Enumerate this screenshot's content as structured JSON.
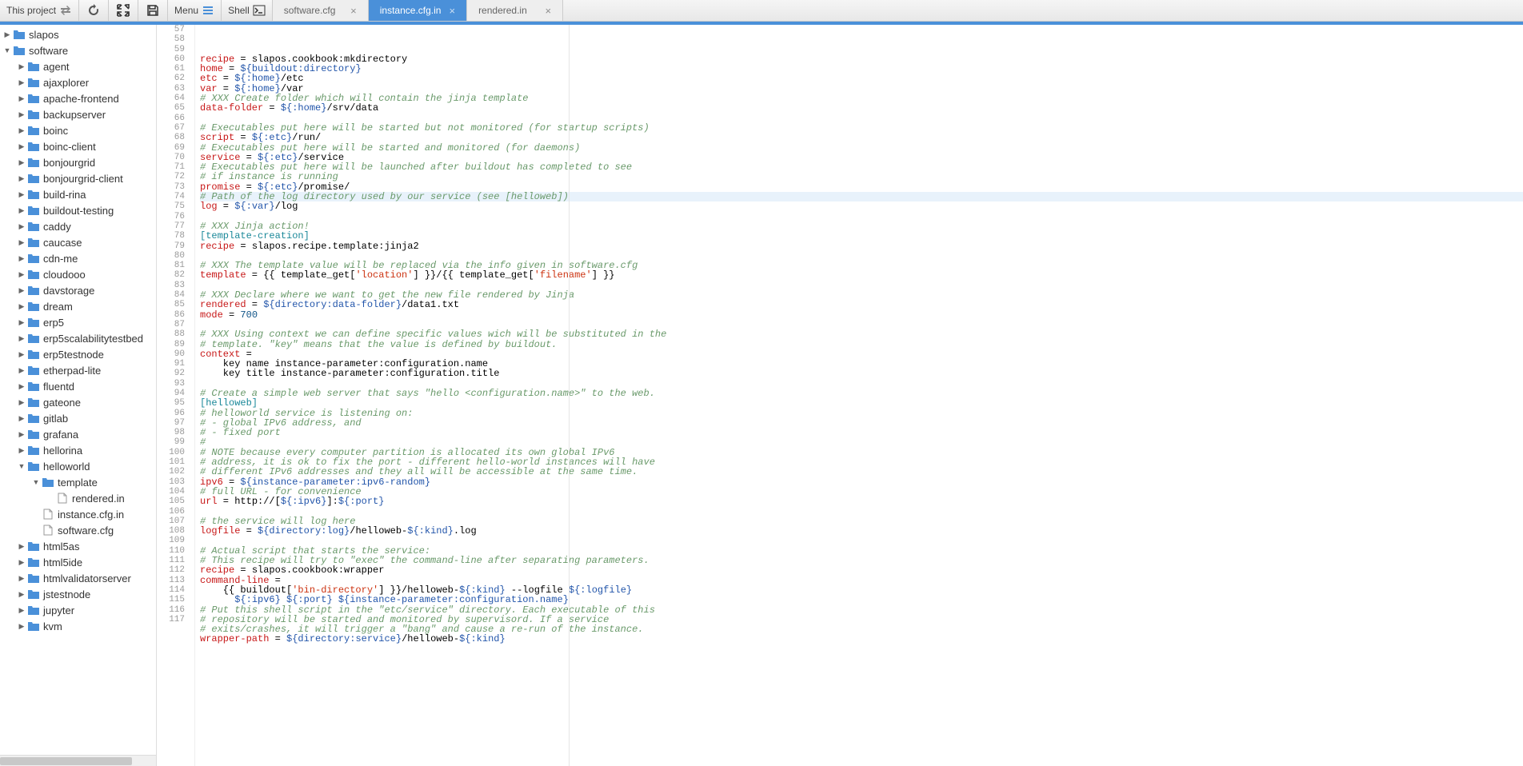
{
  "toolbar": {
    "project_label": "This project",
    "menu_label": "Menu",
    "shell_label": "Shell"
  },
  "tabs": [
    {
      "label": "software.cfg",
      "active": false
    },
    {
      "label": "instance.cfg.in",
      "active": true
    },
    {
      "label": "rendered.in",
      "active": false
    }
  ],
  "tree": [
    {
      "depth": 0,
      "label": "slapos",
      "type": "folder",
      "toggle": "▶"
    },
    {
      "depth": 0,
      "label": "software",
      "type": "folder",
      "toggle": "▼"
    },
    {
      "depth": 1,
      "label": "agent",
      "type": "folder",
      "toggle": "▶"
    },
    {
      "depth": 1,
      "label": "ajaxplorer",
      "type": "folder",
      "toggle": "▶"
    },
    {
      "depth": 1,
      "label": "apache-frontend",
      "type": "folder",
      "toggle": "▶"
    },
    {
      "depth": 1,
      "label": "backupserver",
      "type": "folder",
      "toggle": "▶"
    },
    {
      "depth": 1,
      "label": "boinc",
      "type": "folder",
      "toggle": "▶"
    },
    {
      "depth": 1,
      "label": "boinc-client",
      "type": "folder",
      "toggle": "▶"
    },
    {
      "depth": 1,
      "label": "bonjourgrid",
      "type": "folder",
      "toggle": "▶"
    },
    {
      "depth": 1,
      "label": "bonjourgrid-client",
      "type": "folder",
      "toggle": "▶"
    },
    {
      "depth": 1,
      "label": "build-rina",
      "type": "folder",
      "toggle": "▶"
    },
    {
      "depth": 1,
      "label": "buildout-testing",
      "type": "folder",
      "toggle": "▶"
    },
    {
      "depth": 1,
      "label": "caddy",
      "type": "folder",
      "toggle": "▶"
    },
    {
      "depth": 1,
      "label": "caucase",
      "type": "folder",
      "toggle": "▶"
    },
    {
      "depth": 1,
      "label": "cdn-me",
      "type": "folder",
      "toggle": "▶"
    },
    {
      "depth": 1,
      "label": "cloudooo",
      "type": "folder",
      "toggle": "▶"
    },
    {
      "depth": 1,
      "label": "davstorage",
      "type": "folder",
      "toggle": "▶"
    },
    {
      "depth": 1,
      "label": "dream",
      "type": "folder",
      "toggle": "▶"
    },
    {
      "depth": 1,
      "label": "erp5",
      "type": "folder",
      "toggle": "▶"
    },
    {
      "depth": 1,
      "label": "erp5scalabilitytestbed",
      "type": "folder",
      "toggle": "▶"
    },
    {
      "depth": 1,
      "label": "erp5testnode",
      "type": "folder",
      "toggle": "▶"
    },
    {
      "depth": 1,
      "label": "etherpad-lite",
      "type": "folder",
      "toggle": "▶"
    },
    {
      "depth": 1,
      "label": "fluentd",
      "type": "folder",
      "toggle": "▶"
    },
    {
      "depth": 1,
      "label": "gateone",
      "type": "folder",
      "toggle": "▶"
    },
    {
      "depth": 1,
      "label": "gitlab",
      "type": "folder",
      "toggle": "▶"
    },
    {
      "depth": 1,
      "label": "grafana",
      "type": "folder",
      "toggle": "▶"
    },
    {
      "depth": 1,
      "label": "hellorina",
      "type": "folder",
      "toggle": "▶"
    },
    {
      "depth": 1,
      "label": "helloworld",
      "type": "folder",
      "toggle": "▼"
    },
    {
      "depth": 2,
      "label": "template",
      "type": "folder",
      "toggle": "▼"
    },
    {
      "depth": 3,
      "label": "rendered.in",
      "type": "file",
      "toggle": ""
    },
    {
      "depth": 2,
      "label": "instance.cfg.in",
      "type": "file",
      "toggle": ""
    },
    {
      "depth": 2,
      "label": "software.cfg",
      "type": "file",
      "toggle": ""
    },
    {
      "depth": 1,
      "label": "html5as",
      "type": "folder",
      "toggle": "▶"
    },
    {
      "depth": 1,
      "label": "html5ide",
      "type": "folder",
      "toggle": "▶"
    },
    {
      "depth": 1,
      "label": "htmlvalidatorserver",
      "type": "folder",
      "toggle": "▶"
    },
    {
      "depth": 1,
      "label": "jstestnode",
      "type": "folder",
      "toggle": "▶"
    },
    {
      "depth": 1,
      "label": "jupyter",
      "type": "folder",
      "toggle": "▶"
    },
    {
      "depth": 1,
      "label": "kvm",
      "type": "folder",
      "toggle": "▶"
    }
  ],
  "editor": {
    "first_line": 57,
    "highlighted_line": 71,
    "lines": [
      [
        [
          "recipe",
          "red"
        ],
        [
          " = ",
          ""
        ],
        [
          "slapos.cookbook:mkdirectory",
          ""
        ]
      ],
      [
        [
          "home",
          "red"
        ],
        [
          " = ",
          ""
        ],
        [
          "${buildout:directory}",
          "blue"
        ]
      ],
      [
        [
          "etc",
          "red"
        ],
        [
          " = ",
          ""
        ],
        [
          "${:home}",
          "blue"
        ],
        [
          "/etc",
          ""
        ]
      ],
      [
        [
          "var",
          "red"
        ],
        [
          " = ",
          ""
        ],
        [
          "${:home}",
          "blue"
        ],
        [
          "/var",
          ""
        ]
      ],
      [
        [
          "# XXX Create folder which will contain the jinja template",
          "green"
        ]
      ],
      [
        [
          "data-folder",
          "red"
        ],
        [
          " = ",
          ""
        ],
        [
          "${:home}",
          "blue"
        ],
        [
          "/srv/data",
          ""
        ]
      ],
      [],
      [
        [
          "# Executables put here will be started but not monitored (for startup scripts)",
          "green"
        ]
      ],
      [
        [
          "script",
          "red"
        ],
        [
          " = ",
          ""
        ],
        [
          "${:etc}",
          "blue"
        ],
        [
          "/run/",
          ""
        ]
      ],
      [
        [
          "# Executables put here will be started and monitored (for daemons)",
          "green"
        ]
      ],
      [
        [
          "service",
          "red"
        ],
        [
          " = ",
          ""
        ],
        [
          "${:etc}",
          "blue"
        ],
        [
          "/service",
          ""
        ]
      ],
      [
        [
          "# Executables put here will be launched after buildout has completed to see",
          "green"
        ]
      ],
      [
        [
          "# if instance is running",
          "green"
        ]
      ],
      [
        [
          "promise",
          "red"
        ],
        [
          " = ",
          ""
        ],
        [
          "${:etc}",
          "blue"
        ],
        [
          "/promise/",
          ""
        ]
      ],
      [
        [
          "# Path of the log directory used by our service (see [helloweb])",
          "green"
        ]
      ],
      [
        [
          "log",
          "red"
        ],
        [
          " = ",
          ""
        ],
        [
          "${:var}",
          "blue"
        ],
        [
          "/log",
          ""
        ]
      ],
      [],
      [
        [
          "# XXX Jinja action!",
          "green"
        ]
      ],
      [
        [
          "[template-creation]",
          "teal"
        ]
      ],
      [
        [
          "recipe",
          "red"
        ],
        [
          " = ",
          ""
        ],
        [
          "slapos.recipe.template:jinja2",
          ""
        ]
      ],
      [],
      [
        [
          "# XXX The template value will be replaced via the info given in software.cfg",
          "green"
        ]
      ],
      [
        [
          "template",
          "red"
        ],
        [
          " = ",
          ""
        ],
        [
          "{{ template_get[",
          ""
        ],
        [
          "'location'",
          "str"
        ],
        [
          "] }}/{{ template_get[",
          ""
        ],
        [
          "'filename'",
          "str"
        ],
        [
          "] }}",
          ""
        ]
      ],
      [],
      [
        [
          "# XXX Declare where we want to get the new file rendered by Jinja",
          "green"
        ]
      ],
      [
        [
          "rendered",
          "red"
        ],
        [
          " = ",
          ""
        ],
        [
          "${directory:data-folder}",
          "blue"
        ],
        [
          "/data1.txt",
          ""
        ]
      ],
      [
        [
          "mode",
          "red"
        ],
        [
          " = ",
          ""
        ],
        [
          "700",
          "num"
        ]
      ],
      [],
      [
        [
          "# XXX Using context we can define specific values wich will be substituted in the",
          "green"
        ]
      ],
      [
        [
          "# template. \"key\" means that the value is defined by buildout.",
          "green"
        ]
      ],
      [
        [
          "context",
          "red"
        ],
        [
          " =",
          ""
        ]
      ],
      [
        [
          "    key name instance-parameter:configuration.name",
          ""
        ]
      ],
      [
        [
          "    key title instance-parameter:configuration.title",
          ""
        ]
      ],
      [],
      [
        [
          "# Create a simple web server that says \"hello <configuration.name>\" to the web.",
          "green"
        ]
      ],
      [
        [
          "[helloweb]",
          "teal"
        ]
      ],
      [
        [
          "# helloworld service is listening on:",
          "green"
        ]
      ],
      [
        [
          "# - global IPv6 address, and",
          "green"
        ]
      ],
      [
        [
          "# - fixed port",
          "green"
        ]
      ],
      [
        [
          "#",
          "green"
        ]
      ],
      [
        [
          "# NOTE because every computer partition is allocated its own global IPv6",
          "green"
        ]
      ],
      [
        [
          "# address, it is ok to fix the port - different hello-world instances will have",
          "green"
        ]
      ],
      [
        [
          "# different IPv6 addresses and they all will be accessible at the same time.",
          "green"
        ]
      ],
      [
        [
          "ipv6",
          "red"
        ],
        [
          " = ",
          ""
        ],
        [
          "${instance-parameter:ipv6-random}",
          "blue"
        ]
      ],
      [
        [
          "# full URL - for convenience",
          "green"
        ]
      ],
      [
        [
          "url",
          "red"
        ],
        [
          " = ",
          ""
        ],
        [
          "http://[",
          ""
        ],
        [
          "${:ipv6}",
          "blue"
        ],
        [
          "]:",
          ""
        ],
        [
          "${:port}",
          "blue"
        ]
      ],
      [],
      [
        [
          "# the service will log here",
          "green"
        ]
      ],
      [
        [
          "logfile",
          "red"
        ],
        [
          " = ",
          ""
        ],
        [
          "${directory:log}",
          "blue"
        ],
        [
          "/helloweb-",
          ""
        ],
        [
          "${:kind}",
          "blue"
        ],
        [
          ".log",
          ""
        ]
      ],
      [],
      [
        [
          "# Actual script that starts the service:",
          "green"
        ]
      ],
      [
        [
          "# This recipe will try to \"exec\" the command-line after separating parameters.",
          "green"
        ]
      ],
      [
        [
          "recipe",
          "red"
        ],
        [
          " = ",
          ""
        ],
        [
          "slapos.cookbook:wrapper",
          ""
        ]
      ],
      [
        [
          "command-line",
          "red"
        ],
        [
          " =",
          ""
        ]
      ],
      [
        [
          "    {{ buildout[",
          ""
        ],
        [
          "'bin-directory'",
          "str"
        ],
        [
          "] }}/helloweb-",
          ""
        ],
        [
          "${:kind}",
          "blue"
        ],
        [
          " --logfile ",
          ""
        ],
        [
          "${:logfile}",
          "blue"
        ]
      ],
      [
        [
          "      ",
          ""
        ],
        [
          "${:ipv6}",
          "blue"
        ],
        [
          " ",
          ""
        ],
        [
          "${:port}",
          "blue"
        ],
        [
          " ",
          ""
        ],
        [
          "${instance-parameter:configuration.name}",
          "blue"
        ]
      ],
      [
        [
          "# Put this shell script in the \"etc/service\" directory. Each executable of this",
          "green"
        ]
      ],
      [
        [
          "# repository will be started and monitored by supervisord. If a service",
          "green"
        ]
      ],
      [
        [
          "# exits/crashes, it will trigger a \"bang\" and cause a re-run of the instance.",
          "green"
        ]
      ],
      [
        [
          "wrapper-path",
          "red"
        ],
        [
          " = ",
          ""
        ],
        [
          "${directory:service}",
          "blue"
        ],
        [
          "/helloweb-",
          ""
        ],
        [
          "${:kind}",
          "blue"
        ]
      ],
      []
    ]
  }
}
